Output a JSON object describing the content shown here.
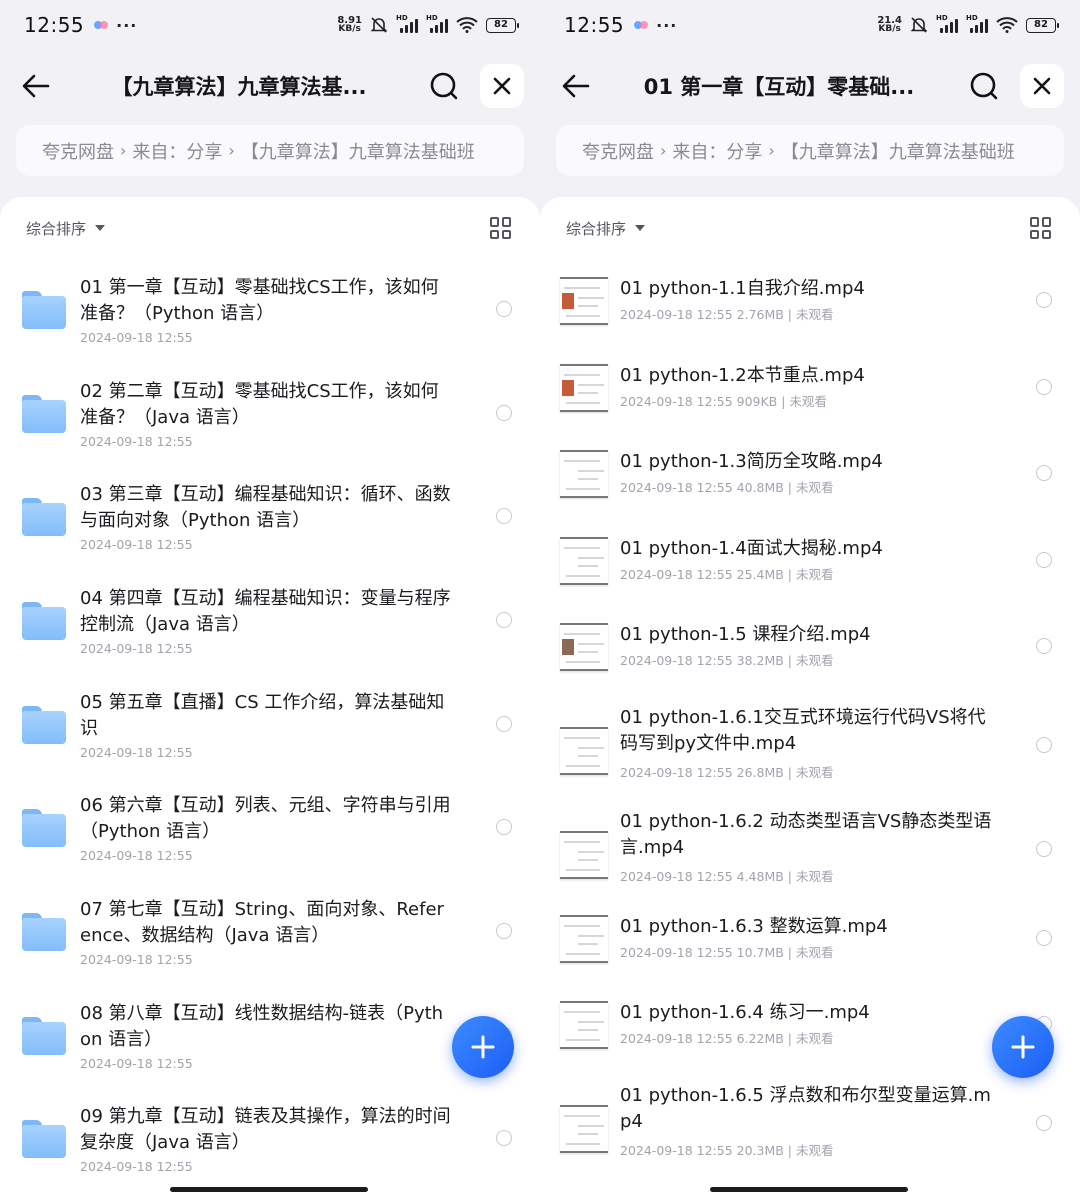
{
  "status": {
    "time": "12:55",
    "battery": "82",
    "left_speed": {
      "value": "8.91",
      "unit": "KB/s"
    },
    "right_speed": {
      "value": "21.4",
      "unit": "KB/s"
    },
    "hd": "HD",
    "more": "···"
  },
  "left": {
    "title": "【九章算法】九章算法基...",
    "breadcrumb": [
      "夸克网盘",
      "来自：分享",
      "【九章算法】九章算法基础班"
    ],
    "sort_label": "综合排序",
    "items": [
      {
        "name": "01 第一章【互动】零基础找CS工作，该如何准备？（Python 语言）",
        "date": "2024-09-18 12:55"
      },
      {
        "name": "02 第二章【互动】零基础找CS工作，该如何准备？（Java 语言）",
        "date": "2024-09-18 12:55"
      },
      {
        "name": "03 第三章【互动】编程基础知识：循环、函数与面向对象（Python 语言）",
        "date": "2024-09-18 12:55"
      },
      {
        "name": "04 第四章【互动】编程基础知识：变量与程序控制流（Java 语言）",
        "date": "2024-09-18 12:55"
      },
      {
        "name": "05 第五章【直播】CS 工作介绍，算法基础知识",
        "date": "2024-09-18 12:55"
      },
      {
        "name": "06 第六章【互动】列表、元组、字符串与引用（Python 语言）",
        "date": "2024-09-18 12:55"
      },
      {
        "name": "07 第七章【互动】String、面向对象、Reference、数据结构（Java 语言）",
        "date": "2024-09-18 12:55"
      },
      {
        "name": "08 第八章【互动】线性数据结构-链表（Python 语言）",
        "date": "2024-09-18 12:55"
      },
      {
        "name": "09 第九章【互动】链表及其操作，算法的时间复杂度（Java 语言）",
        "date": "2024-09-18 12:55"
      }
    ]
  },
  "right": {
    "title": "01 第一章【互动】零基础...",
    "breadcrumb": [
      "夸克网盘",
      "来自：分享",
      "【九章算法】九章算法基础班"
    ],
    "sort_label": "综合排序",
    "items": [
      {
        "name": "01 python-1.1自我介绍.mp4",
        "meta": "2024-09-18 12:55  2.76MB | 未观看"
      },
      {
        "name": "01 python-1.2本节重点.mp4",
        "meta": "2024-09-18 12:55  909KB | 未观看"
      },
      {
        "name": "01 python-1.3简历全攻略.mp4",
        "meta": "2024-09-18 12:55  40.8MB | 未观看"
      },
      {
        "name": "01 python-1.4面试大揭秘.mp4",
        "meta": "2024-09-18 12:55  25.4MB | 未观看"
      },
      {
        "name": "01 python-1.5 课程介绍.mp4",
        "meta": "2024-09-18 12:55  38.2MB | 未观看"
      },
      {
        "name": "01 python-1.6.1交互式环境运行代码VS将代码写到py文件中.mp4",
        "meta": "2024-09-18 12:55  26.8MB | 未观看"
      },
      {
        "name": "01 python-1.6.2 动态类型语言VS静态类型语言.mp4",
        "meta": "2024-09-18 12:55  4.48MB | 未观看"
      },
      {
        "name": "01 python-1.6.3 整数运算.mp4",
        "meta": "2024-09-18 12:55  10.7MB | 未观看"
      },
      {
        "name": "01 python-1.6.4 练习一.mp4",
        "meta": "2024-09-18 12:55  6.22MB | 未观看"
      },
      {
        "name": "01 python-1.6.5 浮点数和布尔型变量运算.mp4",
        "meta": "2024-09-18 12:55  20.3MB | 未观看"
      }
    ]
  }
}
